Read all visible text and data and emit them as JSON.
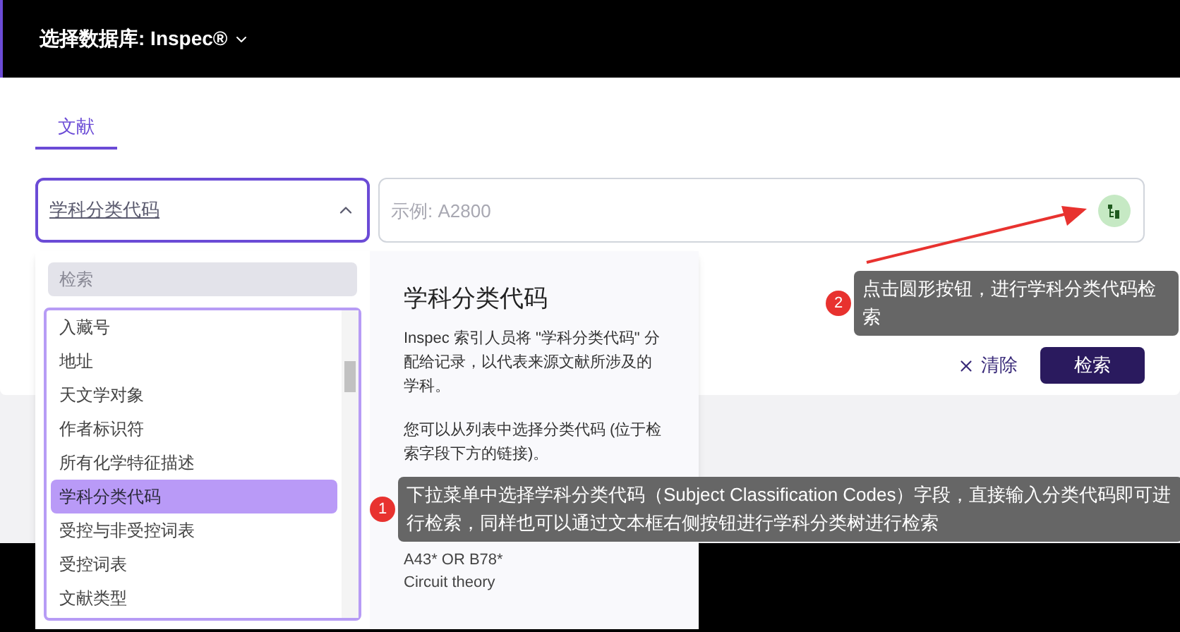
{
  "header": {
    "title": "选择数据库: Inspec®"
  },
  "tabs": [
    {
      "label": "文献",
      "selected": true
    }
  ],
  "field_select": {
    "value": "学科分类代码",
    "expanded": true
  },
  "search_input": {
    "placeholder": "示例: A2800"
  },
  "buttons": [
    {
      "kind": "clear",
      "label": "清除"
    },
    {
      "kind": "search",
      "label": "检索"
    }
  ],
  "dropdown": {
    "search_placeholder": "检索",
    "items": [
      {
        "label": "入藏号",
        "selected": false
      },
      {
        "label": "地址",
        "selected": false
      },
      {
        "label": "天文学对象",
        "selected": false
      },
      {
        "label": "作者标识符",
        "selected": false
      },
      {
        "label": "所有化学特征描述",
        "selected": false
      },
      {
        "label": "学科分类代码",
        "selected": true
      },
      {
        "label": "受控与非受控词表",
        "selected": false
      },
      {
        "label": "受控词表",
        "selected": false
      },
      {
        "label": "文献类型",
        "selected": false
      }
    ],
    "info": {
      "title": "学科分类代码",
      "paragraphs": [
        "Inspec 索引人员将 \"学科分类代码\" 分配给记录，以代表来源文献所涉及的学科。",
        "您可以从列表中选择分类代码 (位于检索字段下方的链接)。"
      ],
      "examples": [
        "A43* OR B78*",
        "Circuit theory"
      ]
    }
  },
  "annotations": [
    {
      "number": "2",
      "text": "点击圆形按钮，进行学科分类代码检索"
    },
    {
      "number": "1",
      "text": "下拉菜单中选择学科分类代码（Subject Classification Codes）字段，直接输入分类代码即可进行检索，同样也可以通过文本框右侧按钮进行学科分类树进行检索"
    }
  ]
}
